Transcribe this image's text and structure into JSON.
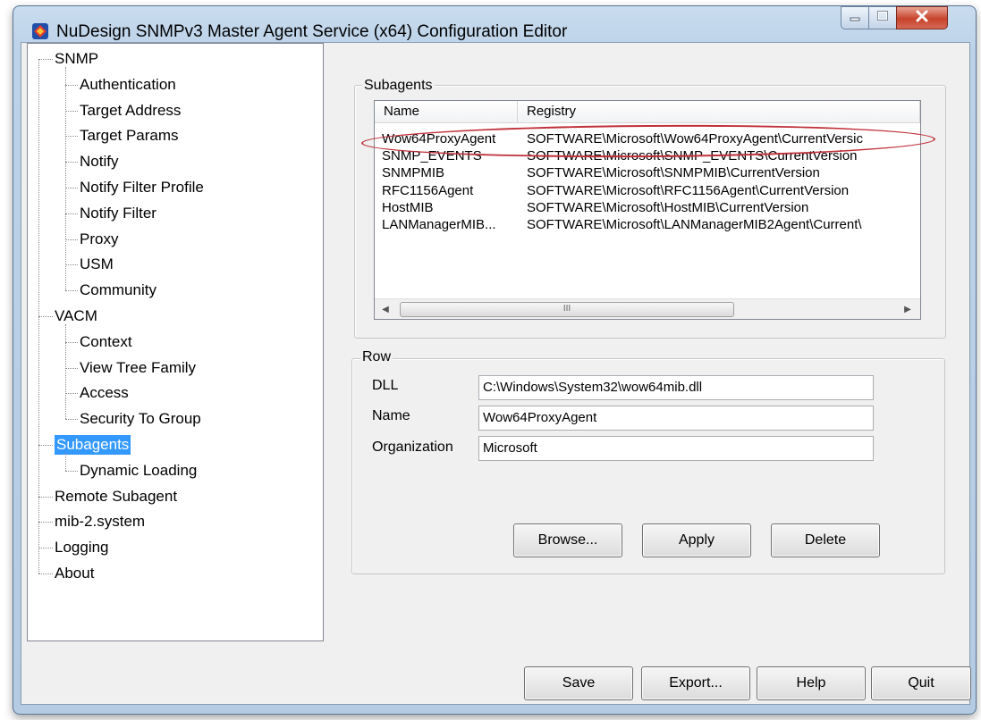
{
  "window": {
    "title": "NuDesign SNMPv3 Master Agent Service (x64) Configuration Editor",
    "controls": {
      "minimize": "minimize-icon",
      "maximize": "maximize-icon",
      "close": "close-icon"
    }
  },
  "tree": {
    "items": [
      {
        "label": "SNMP",
        "level": 0,
        "selected": false
      },
      {
        "label": "Authentication",
        "level": 1,
        "selected": false
      },
      {
        "label": "Target Address",
        "level": 1,
        "selected": false
      },
      {
        "label": "Target Params",
        "level": 1,
        "selected": false
      },
      {
        "label": "Notify",
        "level": 1,
        "selected": false
      },
      {
        "label": "Notify Filter Profile",
        "level": 1,
        "selected": false
      },
      {
        "label": "Notify Filter",
        "level": 1,
        "selected": false
      },
      {
        "label": "Proxy",
        "level": 1,
        "selected": false
      },
      {
        "label": "USM",
        "level": 1,
        "selected": false
      },
      {
        "label": "Community",
        "level": 1,
        "selected": false
      },
      {
        "label": "VACM",
        "level": 0,
        "selected": false
      },
      {
        "label": "Context",
        "level": 1,
        "selected": false
      },
      {
        "label": "View Tree Family",
        "level": 1,
        "selected": false
      },
      {
        "label": "Access",
        "level": 1,
        "selected": false
      },
      {
        "label": "Security To Group",
        "level": 1,
        "selected": false
      },
      {
        "label": "Subagents",
        "level": 0,
        "selected": true
      },
      {
        "label": "Dynamic Loading",
        "level": 1,
        "selected": false
      },
      {
        "label": "Remote Subagent",
        "level": 0,
        "selected": false
      },
      {
        "label": "mib-2.system",
        "level": 0,
        "selected": false
      },
      {
        "label": "Logging",
        "level": 0,
        "selected": false
      },
      {
        "label": "About",
        "level": 0,
        "selected": false
      }
    ]
  },
  "subagents": {
    "group_label": "Subagents",
    "columns": [
      "Name",
      "Registry"
    ],
    "rows": [
      [
        "Wow64ProxyAgent",
        "SOFTWARE\\Microsoft\\Wow64ProxyAgent\\CurrentVersic"
      ],
      [
        "SNMP_EVENTS",
        "SOFTWARE\\Microsoft\\SNMP_EVENTS\\CurrentVersion"
      ],
      [
        "SNMPMIB",
        "SOFTWARE\\Microsoft\\SNMPMIB\\CurrentVersion"
      ],
      [
        "RFC1156Agent",
        "SOFTWARE\\Microsoft\\RFC1156Agent\\CurrentVersion"
      ],
      [
        "HostMIB",
        "SOFTWARE\\Microsoft\\HostMIB\\CurrentVersion"
      ],
      [
        "LANManagerMIB...",
        "SOFTWARE\\Microsoft\\LANManagerMIB2Agent\\Current\\"
      ]
    ],
    "scroll_thumb_glyph": "III"
  },
  "row": {
    "group_label": "Row",
    "dll_label": "DLL",
    "dll_value": "C:\\Windows\\System32\\wow64mib.dll",
    "name_label": "Name",
    "name_value": "Wow64ProxyAgent",
    "org_label": "Organization",
    "org_value": "Microsoft",
    "browse": "Browse...",
    "apply": "Apply",
    "delete": "Delete"
  },
  "footer": {
    "save": "Save",
    "export": "Export...",
    "help": "Help",
    "quit": "Quit"
  }
}
